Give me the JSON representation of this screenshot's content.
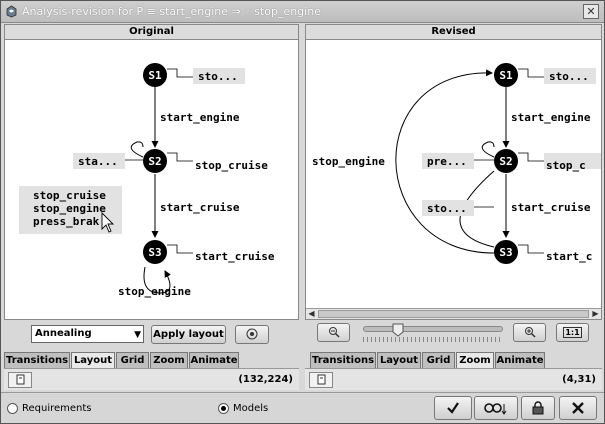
{
  "window": {
    "title": "Analysis-revision for P ≡ start_engine ⇒ ◦ stop_engine"
  },
  "original": {
    "header": "Original",
    "states": [
      "S1",
      "S2",
      "S3"
    ],
    "edge_labels": {
      "s1_s2": "start_engine",
      "s2_s3": "start_cruise",
      "s3_self": "stop_engine"
    },
    "state_labels": {
      "s1": "sto...",
      "s2_left": "sta...",
      "s2_right": "stop_cruise",
      "s3_right": "start_cruise"
    },
    "tooltip": [
      "stop_cruise",
      "stop_engine",
      "press_brak"
    ],
    "layout_select": "Annealing",
    "apply_button": "Apply layout",
    "tabs": [
      "Transitions",
      "Layout",
      "Grid",
      "Zoom",
      "Animate"
    ],
    "active_tab": "Layout",
    "coords": "(132,224)"
  },
  "revised": {
    "header": "Revised",
    "states": [
      "S1",
      "S2",
      "S3"
    ],
    "edge_labels": {
      "s1_s2": "start_engine",
      "s2_s3": "start_cruise",
      "s3_s1": "stop_engine"
    },
    "state_labels": {
      "s1": "sto...",
      "s2_left": "pre...",
      "s2_right": "stop_c",
      "s3_left": "sto...",
      "s3_right": "start_c"
    },
    "zoom_slider_fraction": 0.22,
    "tabs": [
      "Transitions",
      "Layout",
      "Grid",
      "Zoom",
      "Animate"
    ],
    "active_tab": "Zoom",
    "coords": "(4,31)"
  },
  "bottom": {
    "radio_requirements": "Requirements",
    "radio_models": "Models",
    "selected": "Models",
    "actions": [
      "check-icon",
      "search-icon",
      "lock-icon",
      "close-icon"
    ]
  }
}
